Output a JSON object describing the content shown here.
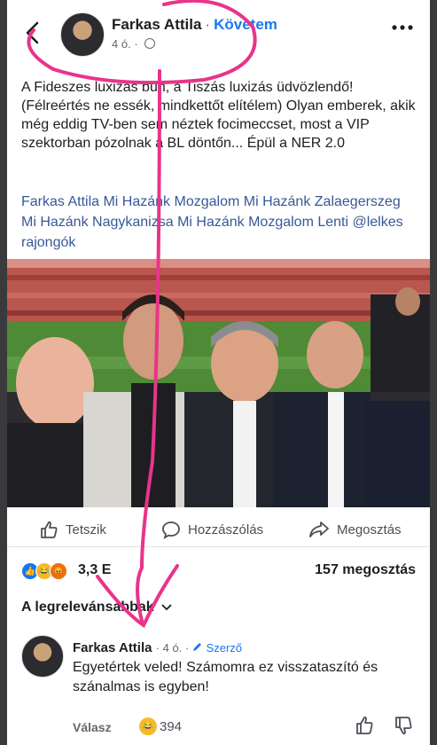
{
  "header": {
    "author": "Farkas Attila",
    "separator": "·",
    "follow_label": "Követem",
    "time": "4 ó.",
    "separator2": "·"
  },
  "post": {
    "text": "A Fideszes luxizás bűn, a Tiszás luxizás üdvözlendő! (Félreértés ne essék, mindkettőt elítélem) Olyan emberek, akik még eddig TV-ben sem néztek focimeccset, most a VIP szektorban pózolnak a BL döntőn... Épül a NER 2.0",
    "tags": "Farkas Attila Mi Hazánk Mozgalom Mi Hazánk Zalaegerszeg Mi Hazánk Nagykanizsa Mi Hazánk Mozgalom Lenti  @lelkes rajongók"
  },
  "actions": {
    "like": "Tetszik",
    "comment": "Hozzászólás",
    "share": "Megosztás"
  },
  "stats": {
    "reactions_count": "3,3 E",
    "shares": "157 megosztás"
  },
  "sort_label": "A legrelevánsabbak",
  "comment": {
    "author": "Farkas Attila",
    "time": "· 4 ó. ·",
    "author_badge": "Szerző",
    "text": "Egyetértek veled! Számomra ez visszataszító és szánalmas is egyben!",
    "reply": "Válasz",
    "reaction_count": "394"
  },
  "colors": {
    "accent": "#1877f2",
    "link": "#385898",
    "annotation": "#e8348a"
  },
  "icons": [
    "back-icon",
    "globe-icon",
    "more-icon",
    "like-icon",
    "comment-icon",
    "share-icon",
    "chevron-down-icon",
    "pencil-icon",
    "thumbs-up-icon",
    "thumbs-down-icon"
  ]
}
